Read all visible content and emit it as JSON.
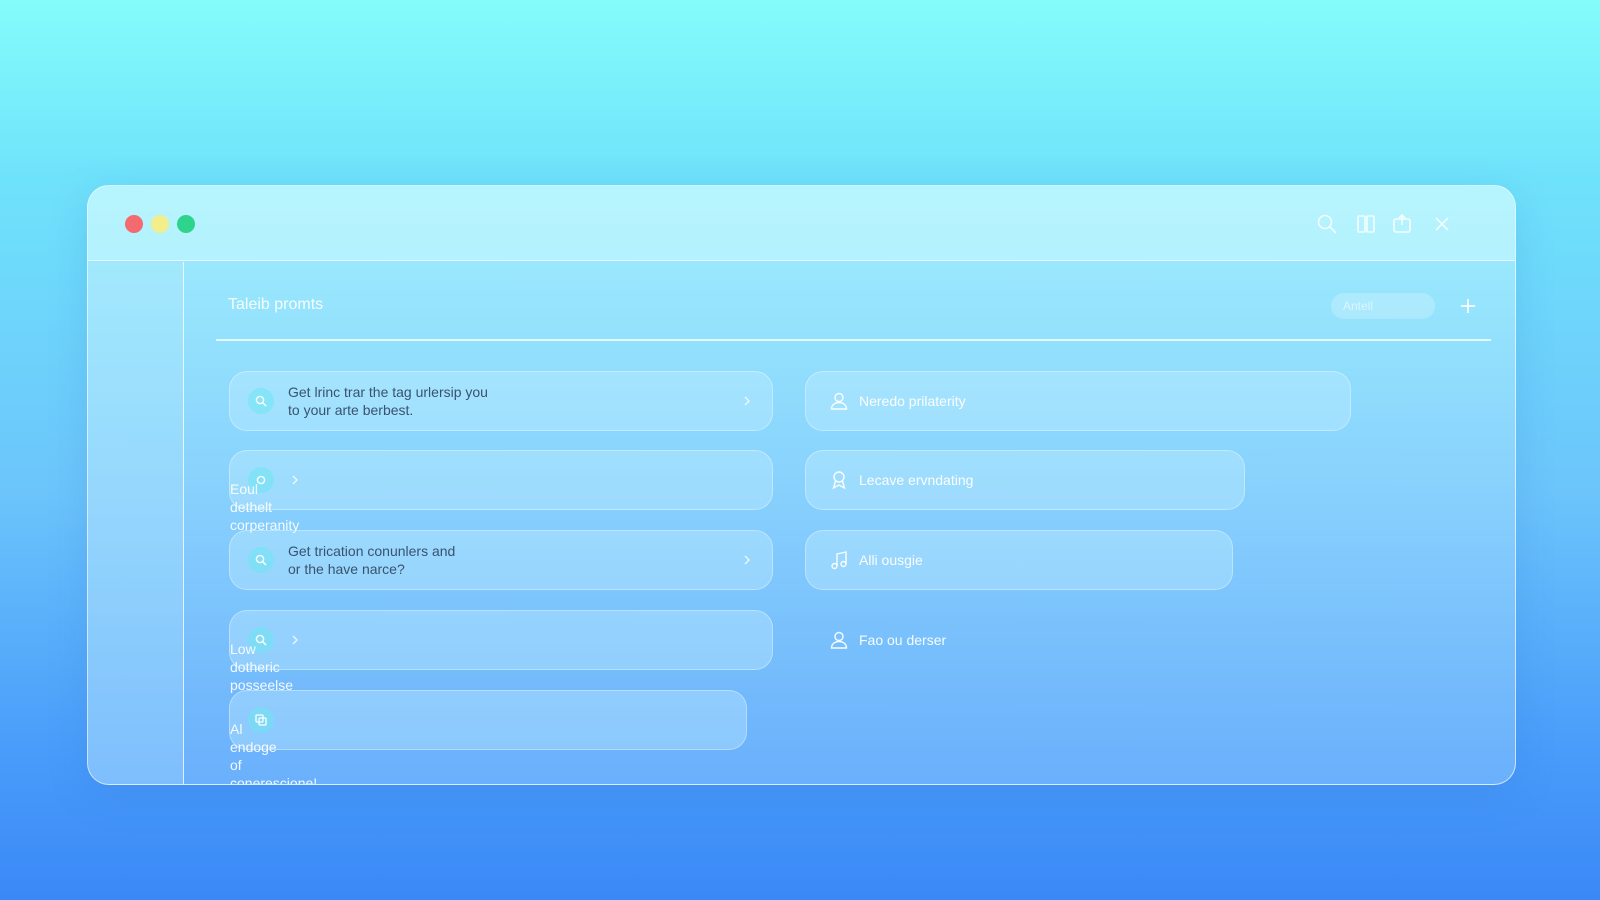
{
  "window": {
    "traffic_lights": [
      "close",
      "minimize",
      "maximize"
    ],
    "toolbar_icons": [
      "search-icon",
      "book-icon",
      "share-icon",
      "close-icon"
    ]
  },
  "main": {
    "title": "Taleib promts",
    "add_placeholder": "Antell",
    "left_prompts": [
      {
        "line1": "Get lrinc trar the tag urlersip you",
        "line2": "to your arte berbest.",
        "icon": "search-icon",
        "style": "dark"
      },
      {
        "line1": "Eoul dethelt corperanity",
        "line2": "",
        "icon": "circle-icon",
        "style": "light"
      },
      {
        "line1": "Get trication conunlers and",
        "line2": "or the have narce?",
        "icon": "search-icon",
        "style": "dark"
      },
      {
        "line1": "Low dotheric posseelse",
        "line2": "",
        "icon": "search-icon",
        "style": "light"
      },
      {
        "line1": "Al endoge of conerescione!",
        "line2": "",
        "icon": "cards-icon",
        "style": "light"
      }
    ],
    "right_prompts": [
      {
        "label": "Neredo prilaterity",
        "icon": "user-icon"
      },
      {
        "label": "Lecave ervndating",
        "icon": "badge-icon"
      },
      {
        "label": "Alli ousgie",
        "icon": "music-icon"
      },
      {
        "label": "Fao ou derser",
        "icon": "user-icon"
      }
    ]
  },
  "colors": {
    "accent": "#6fe6f0",
    "close": "#f36a6f",
    "minimize": "#f2ef8a",
    "maximize": "#2fd48c"
  }
}
